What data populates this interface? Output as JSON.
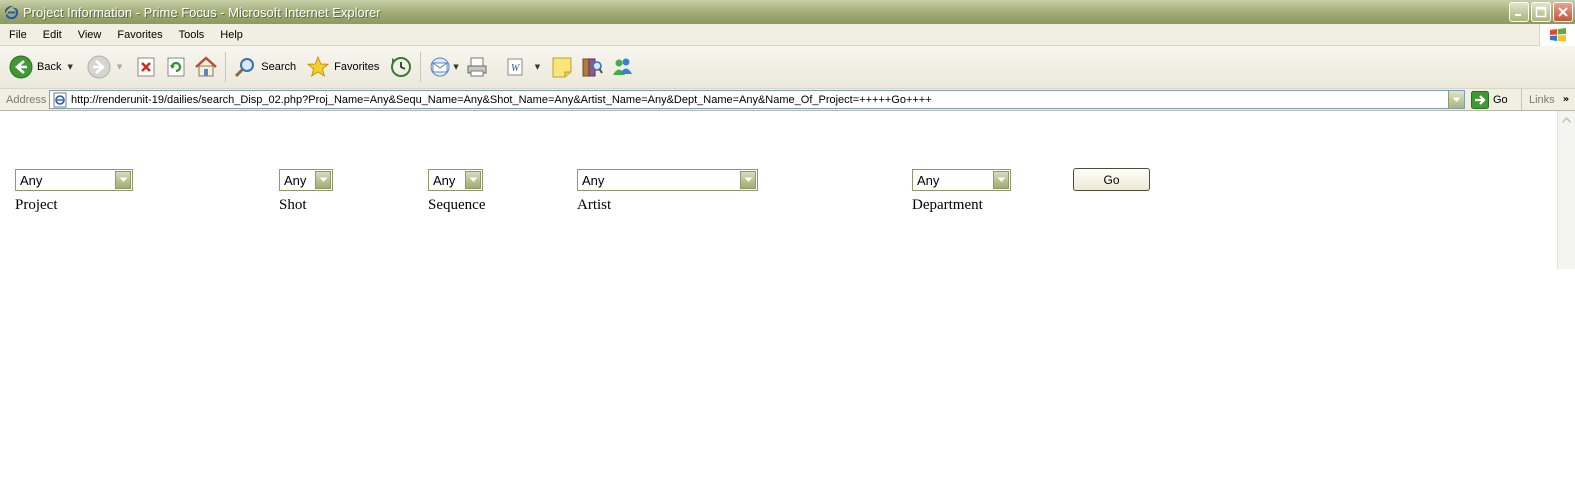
{
  "window": {
    "title": "Project Information - Prime Focus - Microsoft Internet Explorer"
  },
  "menu": [
    "File",
    "Edit",
    "View",
    "Favorites",
    "Tools",
    "Help"
  ],
  "toolbar": {
    "back_label": "Back",
    "search_label": "Search",
    "favorites_label": "Favorites"
  },
  "address": {
    "label": "Address",
    "url": "http://renderunit-19/dailies/search_Disp_02.php?Proj_Name=Any&Sequ_Name=Any&Shot_Name=Any&Artist_Name=Any&Dept_Name=Any&Name_Of_Project=+++++Go++++",
    "go_label": "Go",
    "links_label": "Links"
  },
  "form": {
    "project": {
      "value": "Any",
      "label": "Project"
    },
    "shot": {
      "value": "Any",
      "label": "Shot"
    },
    "sequence": {
      "value": "Any",
      "label": "Sequence"
    },
    "artist": {
      "value": "Any",
      "label": "Artist"
    },
    "department": {
      "value": "Any",
      "label": "Department"
    },
    "go_label": "Go"
  },
  "colors": {
    "titlebar": "#98a46c",
    "chrome": "#f1efe2",
    "select_border": "#8c9a6c"
  }
}
